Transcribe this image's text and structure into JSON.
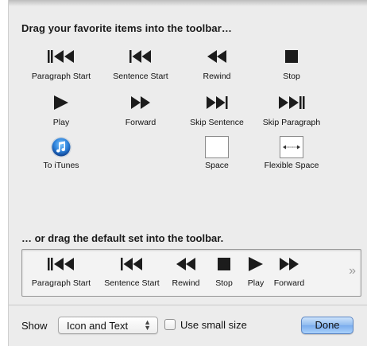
{
  "title": "Drag your favorite items into the toolbar…",
  "items": [
    {
      "label": "Paragraph Start",
      "icon": "paragraph-start-icon"
    },
    {
      "label": "Sentence Start",
      "icon": "sentence-start-icon"
    },
    {
      "label": "Rewind",
      "icon": "rewind-icon"
    },
    {
      "label": "Stop",
      "icon": "stop-icon"
    },
    {
      "label": "Play",
      "icon": "play-icon"
    },
    {
      "label": "Forward",
      "icon": "forward-icon"
    },
    {
      "label": "Skip Sentence",
      "icon": "skip-sentence-icon"
    },
    {
      "label": "Skip Paragraph",
      "icon": "skip-paragraph-icon"
    },
    {
      "label": "To iTunes",
      "icon": "itunes-icon"
    },
    {
      "label": "Space",
      "icon": "space-icon"
    },
    {
      "label": "Flexible Space",
      "icon": "flexible-space-icon"
    }
  ],
  "default_set_title": "… or drag the default set into the toolbar.",
  "default_set": [
    {
      "label": "Paragraph Start",
      "icon": "paragraph-start-icon"
    },
    {
      "label": "Sentence Start",
      "icon": "sentence-start-icon"
    },
    {
      "label": "Rewind",
      "icon": "rewind-icon"
    },
    {
      "label": "Stop",
      "icon": "stop-icon"
    },
    {
      "label": "Play",
      "icon": "play-icon"
    },
    {
      "label": "Forward",
      "icon": "forward-icon"
    }
  ],
  "overflow_glyph": "»",
  "footer": {
    "show_label": "Show",
    "show_value": "Icon and Text",
    "small_size_label": "Use small size",
    "small_size_checked": false,
    "done_label": "Done"
  },
  "colors": {
    "icon": "#1c1c1c",
    "done_accent": "#7aaced"
  }
}
